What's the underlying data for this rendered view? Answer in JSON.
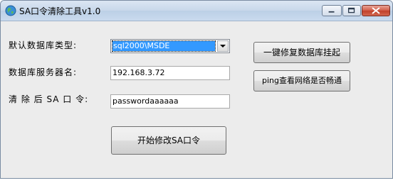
{
  "window": {
    "title": "SA口令清除工具v1.0"
  },
  "form": {
    "db_type_label": "默认数据库类型:",
    "db_type_value": "sql2000\\MSDE",
    "server_label": "数据库服务器名:",
    "server_value": "192.168.3.72",
    "password_label": "清 除 后 SA 口 令:",
    "password_value": "passwordaaaaaa"
  },
  "buttons": {
    "repair": "一键修复数据库挂起",
    "ping": "ping查看网络是否畅通",
    "start": "开始修改SA口令"
  },
  "icons": {
    "app": "globe-icon",
    "minimize": "minimize-icon",
    "maximize": "maximize-icon",
    "close": "close-icon",
    "dropdown": "chevron-down-icon"
  },
  "colors": {
    "selection": "#3399ff",
    "close_button": "#c1412c"
  }
}
